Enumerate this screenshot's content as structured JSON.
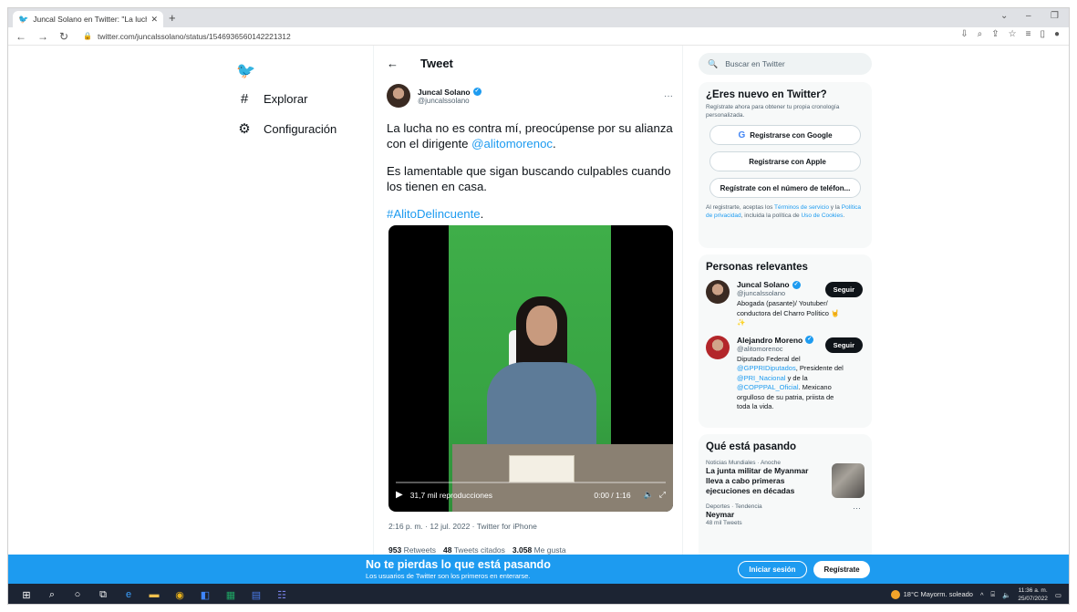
{
  "browser": {
    "tab_title": "Juncal Solano en Twitter: \"La luch",
    "url": "twitter.com/juncalssolano/status/1546936560142221312"
  },
  "nav": {
    "explore": "Explorar",
    "settings": "Configuración"
  },
  "tweet": {
    "header": "Tweet",
    "author_name": "Juncal Solano",
    "author_handle": "@juncalssolano",
    "text_line1": "La lucha no es contra mí, preocúpense por su alianza con el dirigente ",
    "mention": "@alitomorenoc",
    "text_line1_end": ".",
    "text_line2": "Es lamentable que sigan buscando culpables cuando los tienen en casa.",
    "hashtag": "#AlitoDelincuente",
    "hashtag_end": ".",
    "video": {
      "views": "31,7 mil reproducciones",
      "time": "0:00 / 1:16"
    },
    "meta": "2:16 p. m. · 12 jul. 2022 · Twitter for iPhone",
    "stats": {
      "retweets_count": "953",
      "retweets_label": "Retweets",
      "quotes_count": "48",
      "quotes_label": "Tweets citados",
      "likes_count": "3.058",
      "likes_label": "Me gusta"
    }
  },
  "sidebar": {
    "search_placeholder": "Buscar en Twitter",
    "signup": {
      "title": "¿Eres nuevo en Twitter?",
      "subtitle": "Regístrate ahora para obtener tu propia cronología personalizada.",
      "google": "Registrarse con Google",
      "apple": "Registrarse con Apple",
      "phone": "Regístrate con el número de teléfon...",
      "legal_pre": "Al registrarte, aceptas los ",
      "terms": "Términos de servicio",
      "legal_mid": " y la ",
      "privacy": "Política de privacidad",
      "legal_mid2": ", incluida la política de ",
      "cookies": "Uso de Cookies",
      "legal_end": "."
    },
    "relevant": {
      "title": "Personas relevantes",
      "people": [
        {
          "name": "Juncal Solano",
          "handle": "@juncalssolano",
          "bio": "Abogada (pasante)/ Youtuber/ conductora del Charro Político 🤘✨",
          "follow": "Seguir"
        },
        {
          "name": "Alejandro Moreno",
          "handle": "@alitomorenoc",
          "bio_pre": "Diputado Federal del ",
          "bio_link1": "@GPPRIDiputados",
          "bio_mid1": ", Presidente del ",
          "bio_link2": "@PRI_Nacional",
          "bio_mid2": " y de la ",
          "bio_link3": "@COPPPAL_Oficial",
          "bio_end": ". Mexicano orgulloso de su patria, priista de toda la vida.",
          "follow": "Seguir"
        }
      ]
    },
    "trends": {
      "title": "Qué está pasando",
      "items": [
        {
          "category": "Noticias Mundiales · Anoche",
          "title": "La junta militar de Myanmar lleva a cabo primeras ejecuciones en décadas"
        },
        {
          "category": "Deportes · Tendencia",
          "title": "Neymar",
          "count": "48 mil Tweets"
        }
      ]
    }
  },
  "banner": {
    "title": "No te pierdas lo que está pasando",
    "subtitle": "Los usuarios de Twitter son los primeros en enterarse.",
    "login": "Iniciar sesión",
    "register": "Regístrate"
  },
  "taskbar": {
    "weather": "18°C  Mayorm. soleado",
    "time": "11:36 a. m.",
    "date": "25/07/2022"
  },
  "colors": {
    "accent": "#1d9bf0",
    "banner": "#1d9bf0",
    "taskbar": "#1c2433"
  }
}
